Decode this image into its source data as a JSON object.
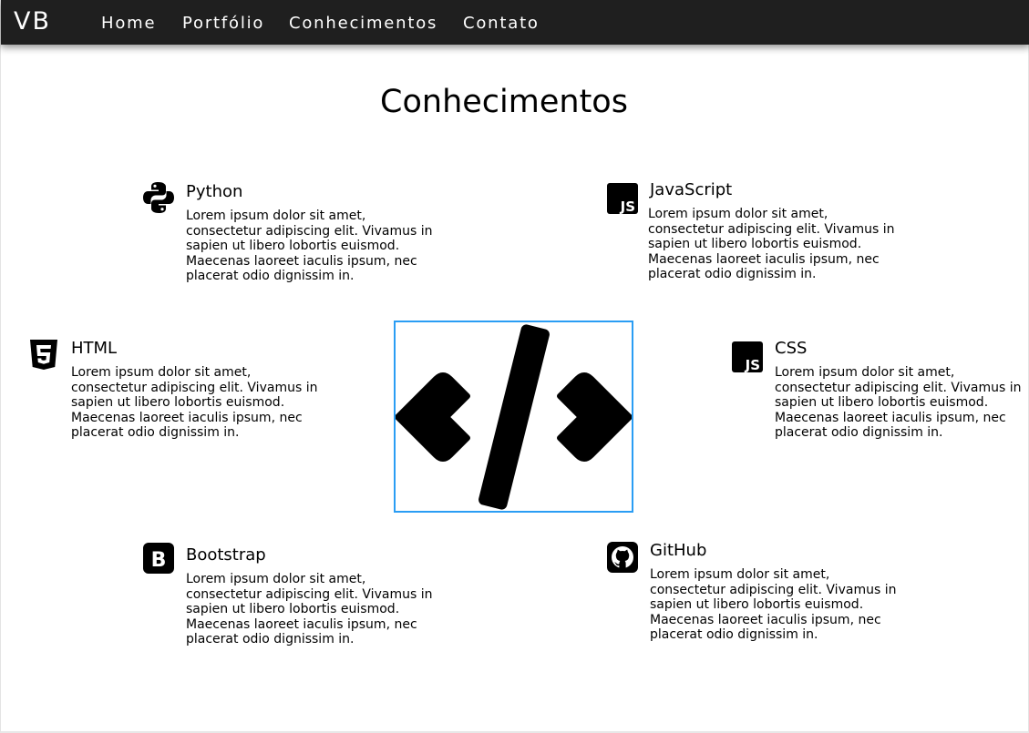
{
  "nav": {
    "brand": "VB",
    "links": [
      "Home",
      "Portfólio",
      "Conhecimentos",
      "Contato"
    ]
  },
  "page_title": "Conhecimentos",
  "skills": [
    {
      "name": "Python",
      "icon": "python-icon",
      "desc": "Lorem ipsum dolor sit amet, consectetur adipiscing elit. Vivamus in sapien ut libero lobortis euismod. Maecenas laoreet iaculis ipsum, nec placerat odio dignissim in."
    },
    {
      "name": "JavaScript",
      "icon": "javascript-icon",
      "desc": "Lorem ipsum dolor sit amet, consectetur adipiscing elit. Vivamus in sapien ut libero lobortis euismod. Maecenas laoreet iaculis ipsum, nec placerat odio dignissim in."
    },
    {
      "name": "HTML",
      "icon": "html5-icon",
      "desc": "Lorem ipsum dolor sit amet, consectetur adipiscing elit. Vivamus in sapien ut libero lobortis euismod. Maecenas laoreet iaculis ipsum, nec placerat odio dignissim in."
    },
    {
      "name": "CSS",
      "icon": "javascript-icon",
      "desc": "Lorem ipsum dolor sit amet, consectetur adipiscing elit. Vivamus in sapien ut libero lobortis euismod. Maecenas laoreet iaculis ipsum, nec placerat odio dignissim in."
    },
    {
      "name": "Bootstrap",
      "icon": "bootstrap-icon",
      "desc": "Lorem ipsum dolor sit amet, consectetur adipiscing elit. Vivamus in sapien ut libero lobortis euismod. Maecenas laoreet iaculis ipsum, nec placerat odio dignissim in."
    },
    {
      "name": "GitHub",
      "icon": "github-icon",
      "desc": "Lorem ipsum dolor sit amet, consectetur adipiscing elit. Vivamus in sapien ut libero lobortis euismod. Maecenas laoreet iaculis ipsum, nec placerat odio dignissim in."
    }
  ],
  "center_image": {
    "icon": "code-brackets-icon"
  },
  "colors": {
    "navbar": "#1f1f1f",
    "accent_border": "#2a9df4"
  },
  "icon_glyphs": {
    "js": "JS",
    "bootstrap": "B",
    "html5": "5"
  }
}
